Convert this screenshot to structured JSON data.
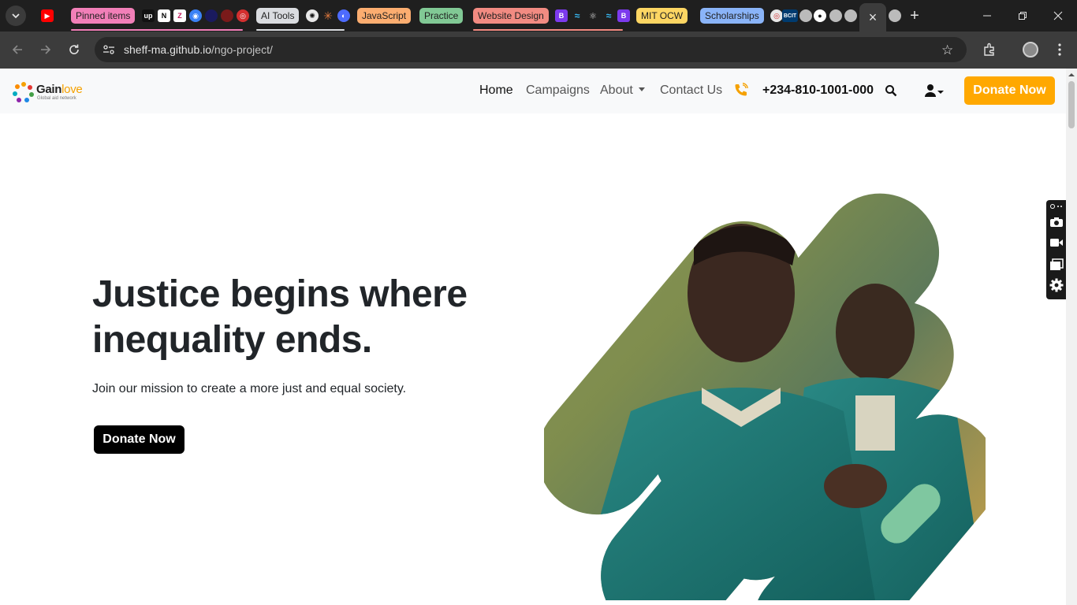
{
  "browser": {
    "tab_groups": [
      {
        "label": "Pinned items",
        "color": "#f27fb8"
      },
      {
        "label": "AI Tools",
        "color": "#dadce0"
      },
      {
        "label": "JavaScript",
        "color": "#fcad70"
      },
      {
        "label": "Practice",
        "color": "#81c995"
      },
      {
        "label": "Website Design",
        "color": "#f28b82"
      },
      {
        "label": "MIT OCW",
        "color": "#fdd663"
      },
      {
        "label": "Scholarships",
        "color": "#8ab4f8"
      }
    ],
    "active_tab_close": "×",
    "new_tab": "+",
    "url_host": "sheff-ma.github.io",
    "url_path": "/ngo-project/"
  },
  "site": {
    "logo_main": "Gain",
    "logo_accent": "love",
    "logo_tagline": "Global aid network",
    "nav": {
      "home": "Home",
      "campaigns": "Campaigns",
      "about": "About",
      "contact": "Contact Us",
      "phone": "+234-810-1001-000",
      "donate": "Donate Now"
    },
    "hero": {
      "title": "Justice begins where inequality ends.",
      "subtitle": "Join our mission to create a more just and equal society.",
      "cta": "Donate Now"
    }
  },
  "colors": {
    "accent": "#ffa800",
    "text_dark": "#212529",
    "navbar_bg": "#f8f9fa"
  }
}
